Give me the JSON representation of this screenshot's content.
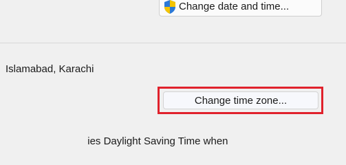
{
  "date_time": {
    "change_button_label": "Change date and time..."
  },
  "time_zone": {
    "current": "Islamabad, Karachi",
    "change_button_label": "Change time zone..."
  },
  "dst": {
    "partial_text": "ies Daylight Saving Time when"
  },
  "colors": {
    "highlight": "#e0212b"
  },
  "icons": {
    "uac": "shield-icon"
  }
}
